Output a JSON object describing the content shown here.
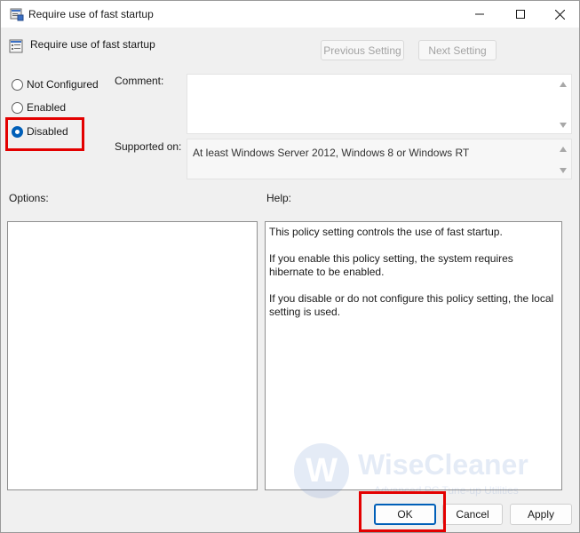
{
  "window": {
    "title": "Require use of fast startup",
    "icon": "policy-icon"
  },
  "header": {
    "title": "Require use of fast startup",
    "previous_label": "Previous Setting",
    "next_label": "Next Setting"
  },
  "state": {
    "options": [
      {
        "label": "Not Configured",
        "checked": false
      },
      {
        "label": "Enabled",
        "checked": false
      },
      {
        "label": "Disabled",
        "checked": true
      }
    ]
  },
  "comment": {
    "label": "Comment:",
    "value": ""
  },
  "supported": {
    "label": "Supported on:",
    "value": "At least Windows Server 2012, Windows 8 or Windows RT"
  },
  "options_panel": {
    "label": "Options:"
  },
  "help_panel": {
    "label": "Help:",
    "paragraphs": [
      "This policy setting controls the use of fast startup.",
      "If you enable this policy setting, the system requires hibernate to be enabled.",
      "If you disable or do not configure this policy setting, the local setting is used."
    ]
  },
  "watermark": {
    "logo_letter": "W",
    "name": "WiseCleaner",
    "tagline": "Advanced PC Tune-up Utilities"
  },
  "buttons": {
    "ok": "OK",
    "cancel": "Cancel",
    "apply": "Apply"
  },
  "colors": {
    "accent": "#005fb8",
    "highlight": "#e30000"
  }
}
